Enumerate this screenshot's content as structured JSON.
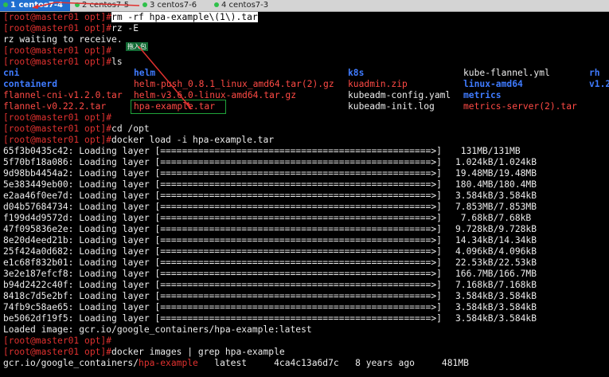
{
  "tabs": [
    {
      "label": "1 centos7-4",
      "color": "#2ec04a"
    },
    {
      "label": "2 centos7-5",
      "color": "#2ec04a"
    },
    {
      "label": "3 centos7-6",
      "color": "#2ec04a"
    },
    {
      "label": "4 centos7-3",
      "color": "#2ec04a"
    }
  ],
  "prompt": "[root@master01 opt]#",
  "annotation": "拖入包",
  "lines": [
    {
      "type": "prompt",
      "cmd": "rm -rf hpa-example\\(1\\).tar",
      "highlight": true
    },
    {
      "type": "prompt",
      "cmd": "rz -E"
    },
    {
      "type": "text",
      "text": "rz waiting to receive."
    },
    {
      "type": "prompt",
      "cmd": ""
    },
    {
      "type": "prompt",
      "cmd": "ls"
    },
    {
      "type": "ls",
      "cells": [
        "cni",
        "helm",
        "k8s",
        "kube-flannel.yml",
        "rh"
      ]
    },
    {
      "type": "ls",
      "cells": [
        "containerd",
        "helm-push_0.8.1_linux_amd64.tar(2).gz",
        "kuadmin.zip",
        "linux-amd64",
        "v1.2"
      ]
    },
    {
      "type": "ls",
      "cells": [
        "flannel-cni-v1.2.0.tar",
        "helm-v3.6.0-linux-amd64.tar.gz",
        "kubeadm-config.yaml",
        "metrics",
        ""
      ]
    },
    {
      "type": "ls",
      "cells": [
        "flannel-v0.22.2.tar",
        "hpa-example.tar",
        "kubeadm-init.log",
        "metrics-server(2).tar",
        ""
      ]
    },
    {
      "type": "prompt",
      "cmd": ""
    },
    {
      "type": "prompt",
      "cmd": "cd /opt"
    },
    {
      "type": "prompt",
      "cmd": "docker load -i hpa-example.tar"
    },
    {
      "type": "layer",
      "id": "65f3b0435c42",
      "size": " 131MB/131MB"
    },
    {
      "type": "layer",
      "id": "5f70bf18a086",
      "size": "1.024kB/1.024kB"
    },
    {
      "type": "layer",
      "id": "9d98bb4454a2",
      "size": "19.48MB/19.48MB"
    },
    {
      "type": "layer",
      "id": "5e383449eb00",
      "size": "180.4MB/180.4MB"
    },
    {
      "type": "layer",
      "id": "e2aa46f0ee7d",
      "size": "3.584kB/3.584kB"
    },
    {
      "type": "layer",
      "id": "d04b57684734",
      "size": "7.853MB/7.853MB"
    },
    {
      "type": "layer",
      "id": "f199d4d9572d",
      "size": " 7.68kB/7.68kB"
    },
    {
      "type": "layer",
      "id": "47f095836e2e",
      "size": "9.728kB/9.728kB"
    },
    {
      "type": "layer",
      "id": "8e20d4eed21b",
      "size": "14.34kB/14.34kB"
    },
    {
      "type": "layer",
      "id": "25f424a0d682",
      "size": "4.096kB/4.096kB"
    },
    {
      "type": "layer",
      "id": "e1c68f832b01",
      "size": "22.53kB/22.53kB"
    },
    {
      "type": "layer",
      "id": "3e2e187efcf8",
      "size": "166.7MB/166.7MB"
    },
    {
      "type": "layer",
      "id": "b94d2422c40f",
      "size": "7.168kB/7.168kB"
    },
    {
      "type": "layer",
      "id": "8418c7d5e2bf",
      "size": "3.584kB/3.584kB"
    },
    {
      "type": "layer",
      "id": "74fb9c58ae65",
      "size": "3.584kB/3.584kB"
    },
    {
      "type": "layer",
      "id": "be5062df19f5",
      "size": "3.584kB/3.584kB"
    },
    {
      "type": "text",
      "text": "Loaded image: gcr.io/google_containers/hpa-example:latest"
    },
    {
      "type": "prompt",
      "cmd": ""
    },
    {
      "type": "prompt",
      "cmd": "docker images | grep hpa-example"
    },
    {
      "type": "image",
      "pre": "gcr.io/google_containers/",
      "hl": "hpa-example",
      "post": "   latest     4ca4c13a6d7c   8 years ago     481MB"
    }
  ],
  "layer_text": ": Loading layer",
  "bar": "[==================================================>]",
  "colors": {
    "prompt": "#e0312f",
    "dir": "#3f7bff",
    "archive": "#ff4a45",
    "box": "#1fa33a",
    "arrow": "#e0312f",
    "tab_active": "#1f6fd0"
  }
}
